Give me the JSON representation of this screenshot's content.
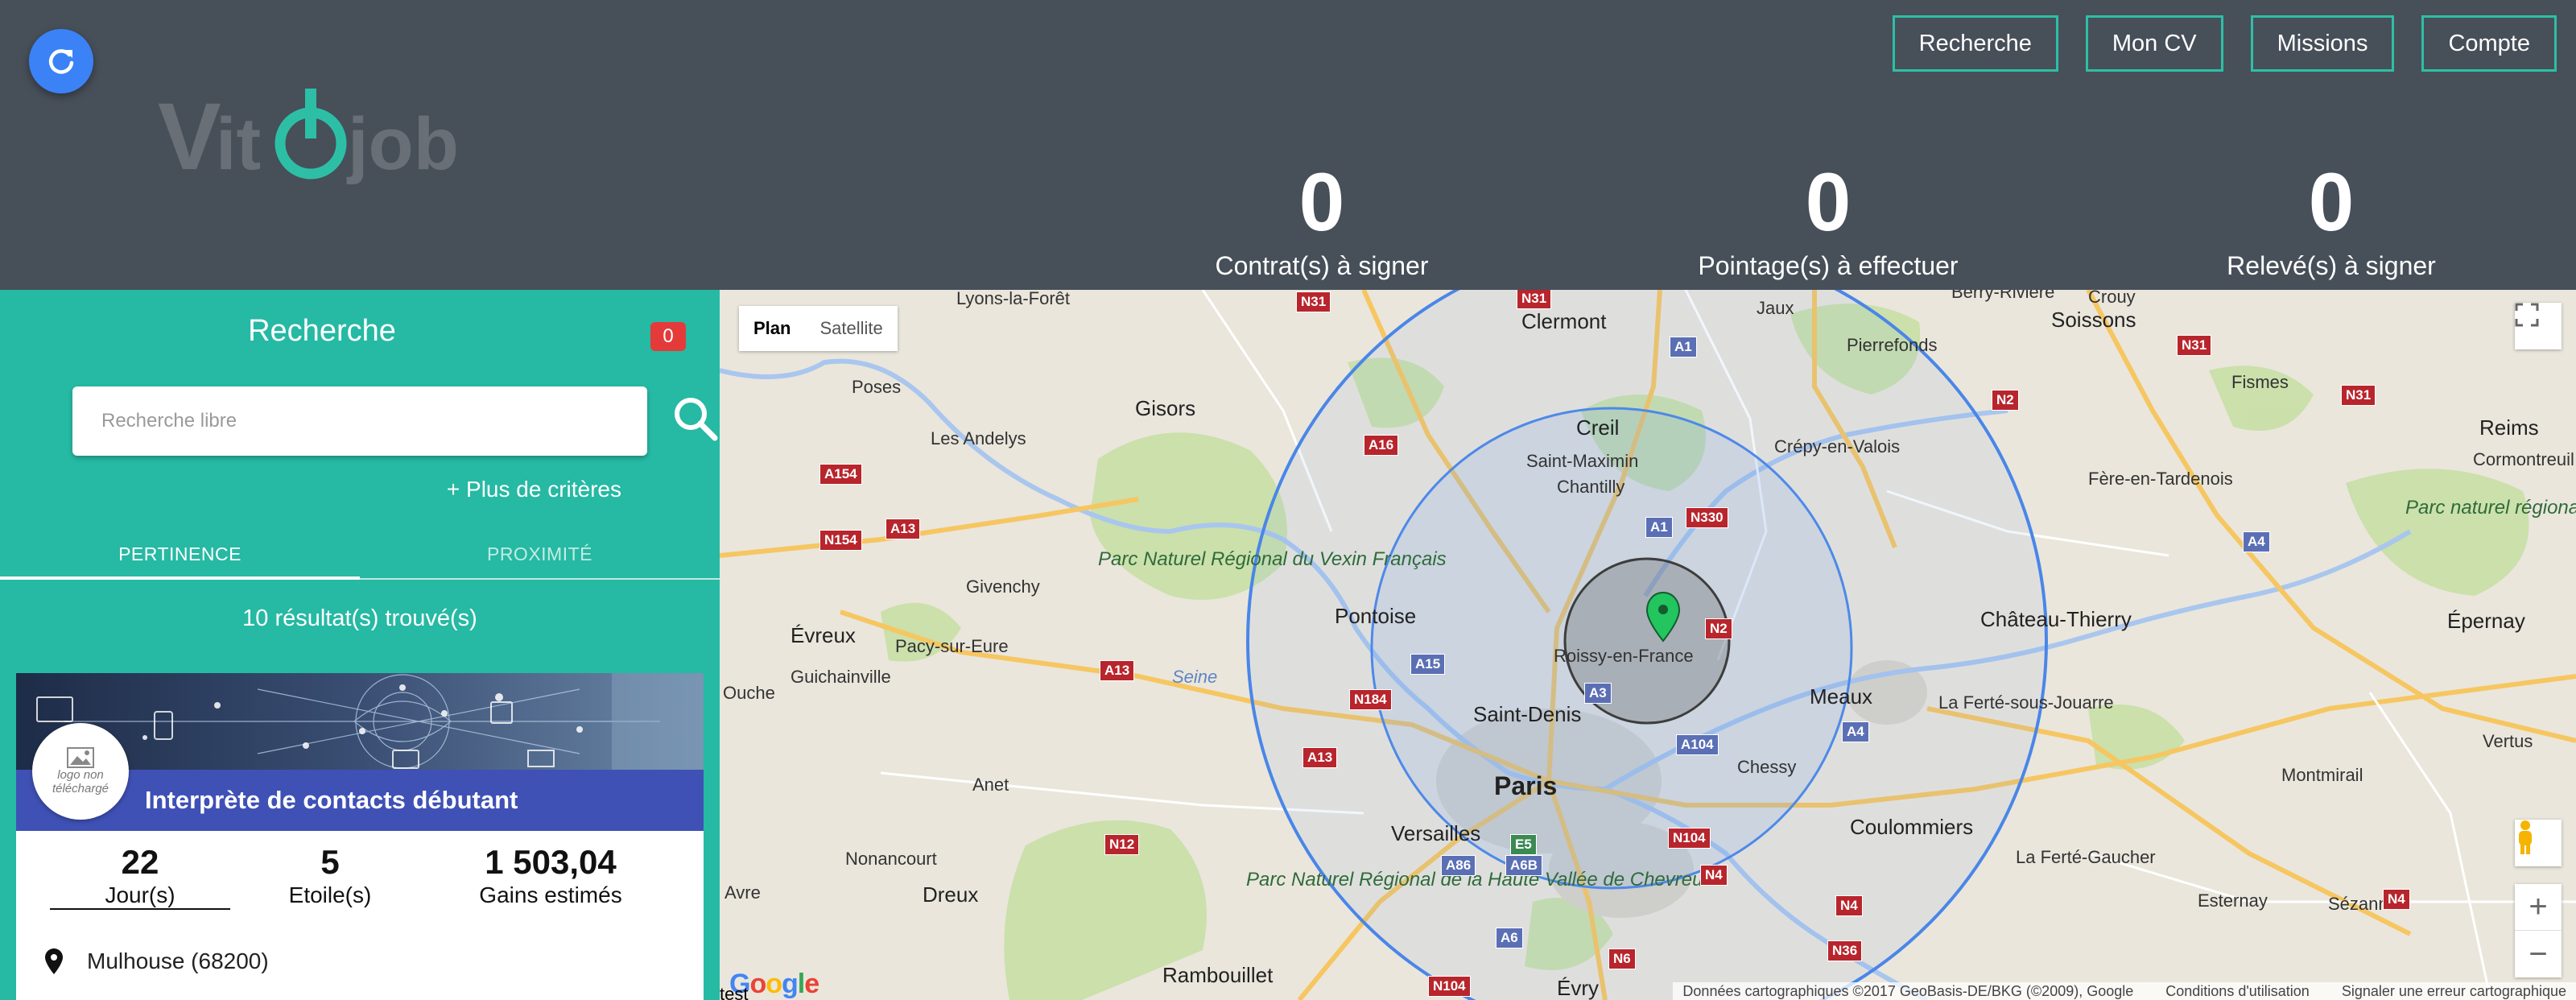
{
  "header": {
    "logo_text": "Vitojob",
    "nav": [
      {
        "label": "Recherche"
      },
      {
        "label": "Mon CV"
      },
      {
        "label": "Missions"
      },
      {
        "label": "Compte"
      }
    ],
    "stats": [
      {
        "value": "0",
        "label": "Contrat(s) à signer"
      },
      {
        "value": "0",
        "label": "Pointage(s) à effectuer"
      },
      {
        "value": "0",
        "label": "Relevé(s) à signer"
      }
    ]
  },
  "panel": {
    "title": "Recherche",
    "badge_count": "0",
    "search_placeholder": "Recherche libre",
    "more_criteria": "+ Plus de critères",
    "tabs": [
      {
        "label": "PERTINENCE",
        "active": true
      },
      {
        "label": "PROXIMITÉ",
        "active": false
      }
    ],
    "results_count": "10 résultat(s) trouvé(s)",
    "card": {
      "logo_text": "logo non téléchargé",
      "title": "Interprète de contacts débutant",
      "stats": [
        {
          "value": "22",
          "label": "Jour(s)"
        },
        {
          "value": "5",
          "label": "Etoile(s)"
        },
        {
          "value": "1 503,04",
          "label": "Gains estimés"
        }
      ],
      "location": "Mulhouse (68200)"
    }
  },
  "map": {
    "type_controls": {
      "plan": "Plan",
      "satellite": "Satellite"
    },
    "zoom_in": "+",
    "zoom_out": "−",
    "footer": {
      "data": "Données cartographiques ©2017 GeoBasis-DE/BKG (©2009), Google",
      "terms": "Conditions d'utilisation",
      "report": "Signaler une erreur cartographique"
    },
    "google_logo": "Google",
    "tiny_text": "test",
    "places": {
      "paris": "Paris",
      "saint_denis": "Saint-Denis",
      "versailles": "Versailles",
      "pontoise": "Pontoise",
      "meaux": "Meaux",
      "creil": "Creil",
      "chantilly": "Chantilly",
      "saint_maximin": "Saint-Maximin",
      "roissy": "Roissy-en-France",
      "chessy": "Chessy",
      "coulommiers": "Coulommiers",
      "rambouillet": "Rambouillet",
      "dreux": "Dreux",
      "evreux": "Évreux",
      "anet": "Anet",
      "nonancourt": "Nonancourt",
      "avre": "Avre",
      "evry": "Évry",
      "gisors": "Gisors",
      "les_andelys": "Les Andelys",
      "lyons": "Lyons-la-Forêt",
      "poses": "Poses",
      "givenchy": "Givenchy",
      "pacy": "Pacy-sur-Eure",
      "guichainville": "Guichainville",
      "ouche": "Ouche",
      "clermont": "Clermont",
      "jaux": "Jaux",
      "pierrefonds": "Pierrefonds",
      "crepy": "Crépy-en-Valois",
      "soissons": "Soissons",
      "crouy": "Crouy",
      "berry": "Berry-Rivière",
      "fismes": "Fismes",
      "reims": "Reims",
      "cormontreuil": "Cormontreuil",
      "fere": "Fère-en-Tardenois",
      "chateau_thierry": "Château-Thierry",
      "epernay": "Épernay",
      "ferte_jouarre": "La Ferté-sous-Jouarre",
      "ferte_gaucher": "La Ferté-Gaucher",
      "montmirail": "Montmirail",
      "vertus": "Vertus",
      "esternay": "Esternay",
      "sezanne": "Sézanne",
      "vexin": "Parc Naturel Régional du Vexin Français",
      "chevreuse": "Parc Naturel Régional de la Haute Vallée de Chevreuse",
      "reims_park": "Parc naturel régional de la Montagne de Reims",
      "seine": "Seine"
    },
    "roads": [
      "N31",
      "N31",
      "A1",
      "A16",
      "A154",
      "A13",
      "N154",
      "A13",
      "A15",
      "N184",
      "A13",
      "A1",
      "N330",
      "N2",
      "A3",
      "A104",
      "N104",
      "A4",
      "N12",
      "A86",
      "A6B",
      "E5",
      "A6",
      "N6",
      "N4",
      "N36",
      "N4",
      "N4",
      "A4",
      "N31",
      "N2",
      "N31",
      "N104"
    ]
  }
}
